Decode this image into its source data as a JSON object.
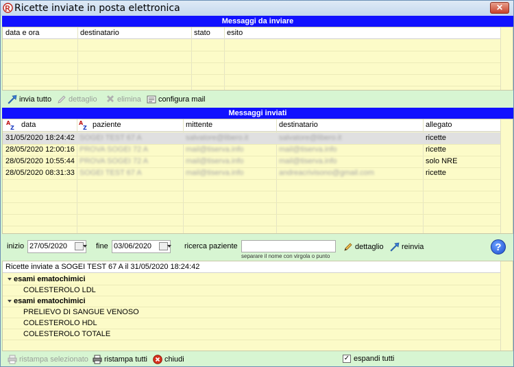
{
  "window": {
    "title": "Ricette inviate in posta elettronica",
    "close_label": "✕"
  },
  "to_send": {
    "header": "Messaggi da inviare",
    "columns": [
      "data e ora",
      "destinatario",
      "stato",
      "esito"
    ]
  },
  "toolbar_top": {
    "send_all": "invia tutto",
    "detail": "dettaglio",
    "delete": "elimina",
    "configure": "configura mail"
  },
  "sent": {
    "header": "Messaggi inviati",
    "columns": {
      "data": "data",
      "paziente": "paziente",
      "mittente": "mittente",
      "destinatario": "destinatario",
      "allegato": "allegato"
    },
    "rows": [
      {
        "data": "31/05/2020 18:24:42",
        "paziente": "SOGEI TEST 67 A",
        "mittente": "salvatore@libero.it",
        "destinatario": "salvatore@libero.it",
        "allegato": "ricette"
      },
      {
        "data": "28/05/2020 12:00:16",
        "paziente": "PROVA SOGEI 72 A",
        "mittente": "mail@tiserva.info",
        "destinatario": "mail@tiserva.info",
        "allegato": "ricette"
      },
      {
        "data": "28/05/2020 10:55:44",
        "paziente": "PROVA SOGEI 72 A",
        "mittente": "mail@tiserva.info",
        "destinatario": "mail@tiserva.info",
        "allegato": "solo NRE"
      },
      {
        "data": "28/05/2020 08:31:33",
        "paziente": "SOGEI TEST 67 A",
        "mittente": "mail@tiserva.info",
        "destinatario": "andreacrivisono@gmail.com",
        "allegato": "ricette"
      }
    ]
  },
  "filters": {
    "start_label": "inizio",
    "start_value": "27/05/2020",
    "end_label": "fine",
    "end_value": "03/06/2020",
    "search_label": "ricerca paziente",
    "search_value": "",
    "search_hint": "separare il nome con virgola o punto",
    "detail": "dettaglio",
    "resend": "reinvia",
    "help": "?"
  },
  "detail": {
    "title": "Ricette inviate a SOGEI TEST 67 A il 31/05/2020 18:24:42",
    "groups": [
      {
        "name": "esami ematochimici",
        "items": [
          "COLESTEROLO LDL"
        ]
      },
      {
        "name": "esami ematochimici",
        "items": [
          "PRELIEVO DI SANGUE VENOSO",
          "COLESTEROLO HDL",
          "COLESTEROLO TOTALE"
        ]
      }
    ]
  },
  "bottom": {
    "reprint_selected": "ristampa selezionato",
    "reprint_all": "ristampa tutti",
    "close": "chiudi",
    "expand_all": "espandi tutti",
    "expand_all_checked": true
  }
}
